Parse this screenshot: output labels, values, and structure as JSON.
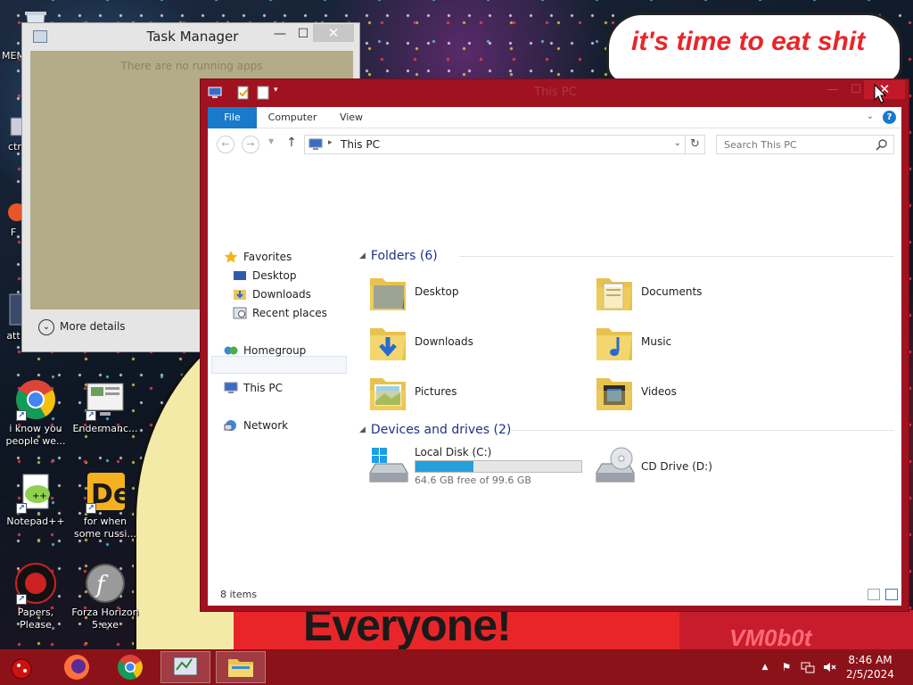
{
  "wallpaper": {
    "speech_text": "it's time to eat shit",
    "banner_text": "Everyone!",
    "watermark": "VM0b0t"
  },
  "desktop_icons": [
    {
      "label": "MEM",
      "icon": "recycle-bin-icon"
    },
    {
      "label": "ctrl-",
      "icon": "shortcut-icon"
    },
    {
      "label": "F",
      "icon": "app-icon"
    },
    {
      "label": "att",
      "icon": "app-icon"
    },
    {
      "label": "i know you people we...",
      "icon": "chrome-icon"
    },
    {
      "label": "Endermanc...",
      "icon": "monitor-icon"
    },
    {
      "label": "Notepad++",
      "icon": "notepad-plus-plus-icon"
    },
    {
      "label": "for when some russi...",
      "icon": "de-icon"
    },
    {
      "label": "Papers, Please",
      "icon": "papers-please-icon"
    },
    {
      "label": "Forza Horizon 5.exe",
      "icon": "flash-icon"
    }
  ],
  "task_manager": {
    "title": "Task Manager",
    "minimize": "—",
    "maximize": "☐",
    "close": "✕",
    "empty_text": "There are no running apps",
    "more_details": "More details"
  },
  "explorer": {
    "title": "This PC",
    "minimize": "—",
    "maximize": "☐",
    "close": "✕",
    "ribbon_tabs": [
      "File",
      "Computer",
      "View"
    ],
    "address": "This PC",
    "search_placeholder": "Search This PC",
    "nav_pane": {
      "favorites": "Favorites",
      "desktop": "Desktop",
      "downloads": "Downloads",
      "recent": "Recent places",
      "homegroup": "Homegroup",
      "this_pc": "This PC",
      "network": "Network"
    },
    "folders_header": "Folders (6)",
    "folders": [
      "Desktop",
      "Documents",
      "Downloads",
      "Music",
      "Pictures",
      "Videos"
    ],
    "devices_header": "Devices and drives (2)",
    "drives": {
      "local_name": "Local Disk (C:)",
      "local_free": "64.6 GB free of 99.6 GB",
      "used_fraction": 0.35,
      "cd_name": "CD Drive (D:)"
    },
    "status": "8 items"
  },
  "taskbar": {
    "time": "8:46 AM",
    "date": "2/5/2024"
  },
  "colors": {
    "window_frame": "#a01220",
    "taskbar": "#8c1219",
    "accent": "#1979ca",
    "drive_bar": "#26a0da"
  }
}
